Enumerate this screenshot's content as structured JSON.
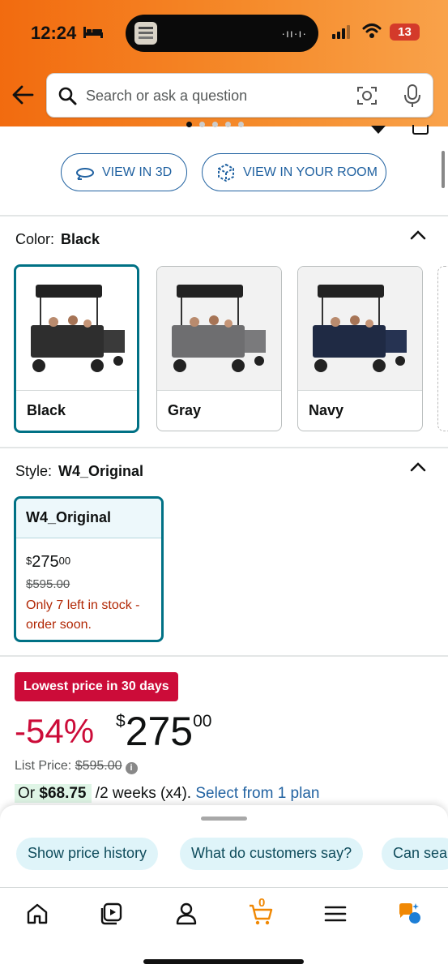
{
  "status_bar": {
    "time": "12:24",
    "battery": "13"
  },
  "search": {
    "placeholder": "Search or ask a question"
  },
  "view_buttons": {
    "view_3d": "VIEW IN 3D",
    "view_room": "VIEW IN YOUR ROOM"
  },
  "color": {
    "label": "Color:",
    "selected": "Black",
    "options": [
      {
        "name": "Black"
      },
      {
        "name": "Gray"
      },
      {
        "name": "Navy"
      }
    ]
  },
  "style": {
    "label": "Style:",
    "selected": "W4_Original",
    "card": {
      "name": "W4_Original",
      "price_symbol": "$",
      "price_whole": "275",
      "price_fraction": "00",
      "list_price": "$595.00",
      "stock": "Only 7 left in stock - order soon."
    }
  },
  "deal": {
    "badge": "Lowest price in 30 days",
    "discount": "-54%",
    "price_symbol": "$",
    "price_whole": "275",
    "price_fraction": "00",
    "list_price_label": "List Price:",
    "list_price": "$595.00",
    "plan_prefix": "Or",
    "plan_amount": "$68.75",
    "plan_terms": "/2 weeks (x4).",
    "plan_link": "Select from 1 plan"
  },
  "chips": [
    "Show price history",
    "What do customers say?",
    "Can sea"
  ],
  "nav": {
    "cart_count": "0"
  },
  "colors": {
    "accent": "#f26b0f",
    "teal": "#007185",
    "deal_red": "#cc0c39",
    "link": "#2162a1"
  }
}
